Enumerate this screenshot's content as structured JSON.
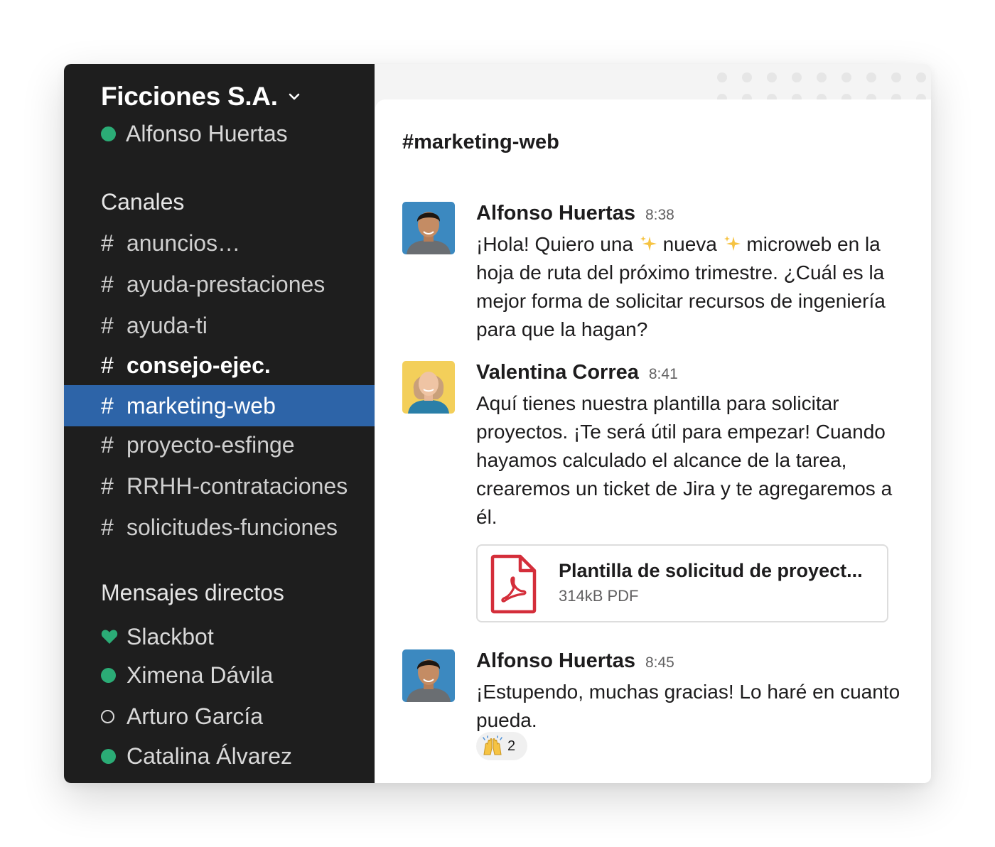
{
  "workspace": {
    "name": "Ficciones S.A."
  },
  "current_user": {
    "name": "Alfonso Huertas",
    "status": "online"
  },
  "sidebar": {
    "channels_title": "Canales",
    "channels": [
      {
        "name": "anuncios…",
        "bold": false,
        "active": false
      },
      {
        "name": "ayuda-prestaciones",
        "bold": false,
        "active": false
      },
      {
        "name": "ayuda-ti",
        "bold": false,
        "active": false
      },
      {
        "name": "consejo-ejec.",
        "bold": true,
        "active": false
      },
      {
        "name": "marketing-web",
        "bold": false,
        "active": true
      },
      {
        "name": "proyecto-esfinge",
        "bold": false,
        "active": false
      },
      {
        "name": "RRHH-contrataciones",
        "bold": false,
        "active": false
      },
      {
        "name": "solicitudes-funciones",
        "bold": false,
        "active": false
      }
    ],
    "dm_title": "Mensajes directos",
    "dms": [
      {
        "name": "Slackbot",
        "icon": "heart-icon"
      },
      {
        "name": "Ximena Dávila",
        "status": "online"
      },
      {
        "name": "Arturo García",
        "status": "away"
      },
      {
        "name": "Catalina Álvarez",
        "status": "online"
      }
    ]
  },
  "channel": {
    "title": "#marketing-web"
  },
  "messages": [
    {
      "sender": "Alfonso Huertas",
      "time": "8:38",
      "parts": [
        "¡Hola! Quiero una ",
        " nueva ",
        " microweb en la hoja de ruta del próximo trimestre. ¿Cuál es la mejor forma de solicitar recursos de ingeniería para que la hagan?"
      ]
    },
    {
      "sender": "Valentina Correa",
      "time": "8:41",
      "text": "Aquí tienes nuestra plantilla para solicitar proyectos. ¡Te será útil para empezar! Cuando hayamos calculado el alcance de la tarea, crearemos un ticket de Jira y te agregaremos a él.",
      "attachment": {
        "name": "Plantilla de solicitud de proyect...",
        "meta": "314kB PDF",
        "icon": "pdf-icon"
      }
    },
    {
      "sender": "Alfonso Huertas",
      "time": "8:45",
      "text": "¡Estupendo, muchas gracias! Lo haré en cuanto pueda.",
      "reaction": {
        "emoji": "raised-hands-icon",
        "count": "2"
      }
    }
  ],
  "colors": {
    "sidebar_bg": "#1e1e1e",
    "active_channel": "#2d64a8",
    "online": "#2bac76",
    "pdf_red": "#d42e3a"
  }
}
